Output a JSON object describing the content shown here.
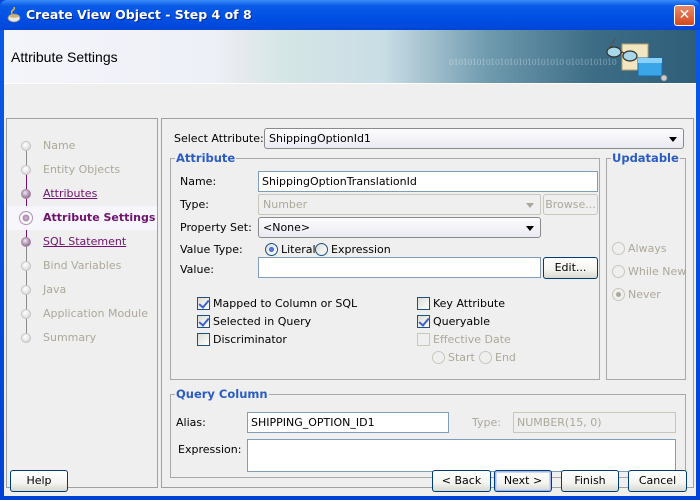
{
  "window": {
    "title": "Create View Object - Step 4 of 8",
    "close_label": "✕"
  },
  "header": {
    "title": "Attribute Settings",
    "binary_text": "0101010101010101010101010 01010101010"
  },
  "nav": {
    "items": [
      {
        "label": "Name",
        "state": "disabled"
      },
      {
        "label": "Entity Objects",
        "state": "disabled"
      },
      {
        "label": "Attributes",
        "state": "visited"
      },
      {
        "label": "Attribute Settings",
        "state": "current"
      },
      {
        "label": "SQL Statement",
        "state": "visited"
      },
      {
        "label": "Bind Variables",
        "state": "disabled"
      },
      {
        "label": "Java",
        "state": "disabled"
      },
      {
        "label": "Application Module",
        "state": "disabled"
      },
      {
        "label": "Summary",
        "state": "disabled"
      }
    ]
  },
  "select_attribute": {
    "label": "Select Attribute:",
    "value": "ShippingOptionId1"
  },
  "attribute_group": {
    "title": "Attribute",
    "name_label": "Name:",
    "name_value": "ShippingOptionTranslationId",
    "type_label": "Type:",
    "type_value": "Number",
    "browse_label": "Browse...",
    "property_set_label": "Property Set:",
    "property_set_value": "<None>",
    "value_type_label": "Value Type:",
    "value_type_options": [
      {
        "label": "Literal",
        "selected": true
      },
      {
        "label": "Expression",
        "selected": false
      }
    ],
    "value_label": "Value:",
    "value_value": "",
    "edit_label": "Edit...",
    "checkboxes_left": [
      {
        "label": "Mapped to Column or SQL",
        "checked": true,
        "enabled": true
      },
      {
        "label": "Selected in Query",
        "checked": true,
        "enabled": true
      },
      {
        "label": "Discriminator",
        "checked": false,
        "enabled": true
      }
    ],
    "checkboxes_right": [
      {
        "label": "Key Attribute",
        "checked": false,
        "enabled": true
      },
      {
        "label": "Queryable",
        "checked": true,
        "enabled": true
      },
      {
        "label": "Effective Date",
        "checked": false,
        "enabled": false
      }
    ],
    "effective_date_options": [
      {
        "label": "Start",
        "selected": false
      },
      {
        "label": "End",
        "selected": false
      }
    ]
  },
  "updatable_group": {
    "title": "Updatable",
    "options": [
      {
        "label": "Always",
        "selected": false
      },
      {
        "label": "While New",
        "selected": false
      },
      {
        "label": "Never",
        "selected": true
      }
    ]
  },
  "query_column_group": {
    "title": "Query Column",
    "alias_label": "Alias:",
    "alias_value": "SHIPPING_OPTION_ID1",
    "type_label": "Type:",
    "type_value": "NUMBER(15, 0)",
    "expression_label": "Expression:",
    "expression_value": ""
  },
  "footer": {
    "help_label": "Help",
    "back_label": "< Back",
    "next_label": "Next >",
    "finish_label": "Finish",
    "cancel_label": "Cancel"
  }
}
